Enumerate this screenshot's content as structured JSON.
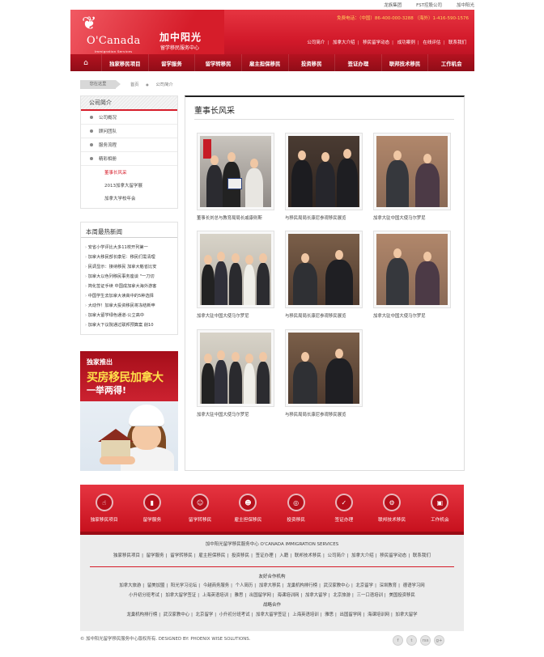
{
  "topbar": {
    "links": [
      "龙族集团",
      "FST控股公司",
      "加中阳光"
    ]
  },
  "brand": {
    "logo_text": "O'Canada",
    "logo_sub": "Immigration Services",
    "name_cn": "加中阳光",
    "name_cn_sub": "留学移民服务中心",
    "phone_label": "免费电话：（中国）86-400-000-3288",
    "phone_label2": "（海外）1-416-590-1576"
  },
  "quicklinks": [
    "公司简介",
    "加拿大介绍",
    "移民留学动态",
    "成功案例",
    "在线评估",
    "联系我们"
  ],
  "nav": [
    "独家移民项目",
    "留学服务",
    "留学转移民",
    "雇主担保移民",
    "投资移民",
    "签证办理",
    "联邦技术移民",
    "工作机会"
  ],
  "breadcrumb": {
    "here": "您在这里",
    "home": "首页",
    "current": "公司简介"
  },
  "sidebar": {
    "heading": "公司简介",
    "items": [
      "公司概况",
      "顾问团队",
      "服务流程",
      "精彩相册"
    ],
    "subitems": [
      "董事长风采",
      "2013加拿大留学展",
      "加拿大学校年会"
    ],
    "active_sub": "董事长风采"
  },
  "news": {
    "title": "本周最热新闻",
    "items": [
      "安省小学评比大多11校开列第一",
      "加拿大移民部长康尼：移民们需清理",
      "民调显示：接纳移民 加拿大魁省比安",
      "加拿大以色列移民事务座谈 \"一刀切",
      "简化签证手续 中国成加拿大海外游客",
      "中国学生去加拿大读高中的5种选择",
      "大动作！加拿大投资移民将冻结新申",
      "加拿大留学绿色通道-公立高中",
      "加拿大下议院通过联邦预算案 削10"
    ]
  },
  "ad": {
    "line1": "独家推出",
    "line2": "买房移民加拿大",
    "line3": "一举两得!"
  },
  "main": {
    "title": "董事长风采",
    "photos": [
      {
        "caption": "董事长刘总与教育局局长戚康则斯"
      },
      {
        "caption": "与移民局局长康尼参观移民展览"
      },
      {
        "caption": "加拿大驻中国大使马尔罗尼"
      },
      {
        "caption": "加拿大驻中国大使马尔罗尼"
      },
      {
        "caption": "与移民局局长康尼参观移民展览"
      },
      {
        "caption": "加拿大驻中国大使马尔罗尼"
      },
      {
        "caption": "加拿大驻中国大使马尔罗尼"
      },
      {
        "caption": "与移民局局长康尼参观移民展览"
      }
    ]
  },
  "footer": {
    "icons": [
      "独家移民项目",
      "留学服务",
      "留学转移民",
      "雇主担保移民",
      "投资移民",
      "签证办理",
      "联邦技术移民",
      "工作机会"
    ],
    "org": "加中阳光留学移民服务中心   O'CANADA IMMIGRATION SERVICES",
    "links": [
      "独家移民项目",
      "留学服务",
      "留学转移民",
      "雇主担保移民",
      "投资移民",
      "签证办理",
      "入籍",
      "联邦技术移民",
      "公司简介",
      "加拿大介绍",
      "移民留学动态",
      "联系我们"
    ],
    "partners_title": "友好合作机构",
    "partners_row1": [
      "加拿大旅游",
      "留美加盟",
      "阳光学习论坛",
      "今越商务服务",
      "个人简历",
      "加拿大移民",
      "龙巢机构排行榜",
      "武汉家教中心",
      "北京留学",
      "深圳教育",
      "德语学习网"
    ],
    "partners_row2": [
      "小升初分班考试",
      "加拿大留学签证",
      "上海英语培训",
      "雅思",
      "出国留学网",
      "海课培训网",
      "加拿大留学",
      "北京旅游",
      "三一口语培训",
      "美国投资移民"
    ],
    "strategic_title": "战略合作",
    "strategic_row": [
      "龙巢机构排行榜",
      "武汉家教中心",
      "北京留学",
      "小升初分班考试",
      "加拿大留学签证",
      "上海英语培训",
      "雅思",
      "出国留学网",
      "海课培训网",
      "加拿大留学"
    ],
    "copyright": "© 加中阳光留学移民服务中心版权所有.     DESIGNED BY: PHOENIX WISE SOLUTIONS."
  },
  "social": [
    "f",
    "t",
    "rss",
    "g+"
  ]
}
